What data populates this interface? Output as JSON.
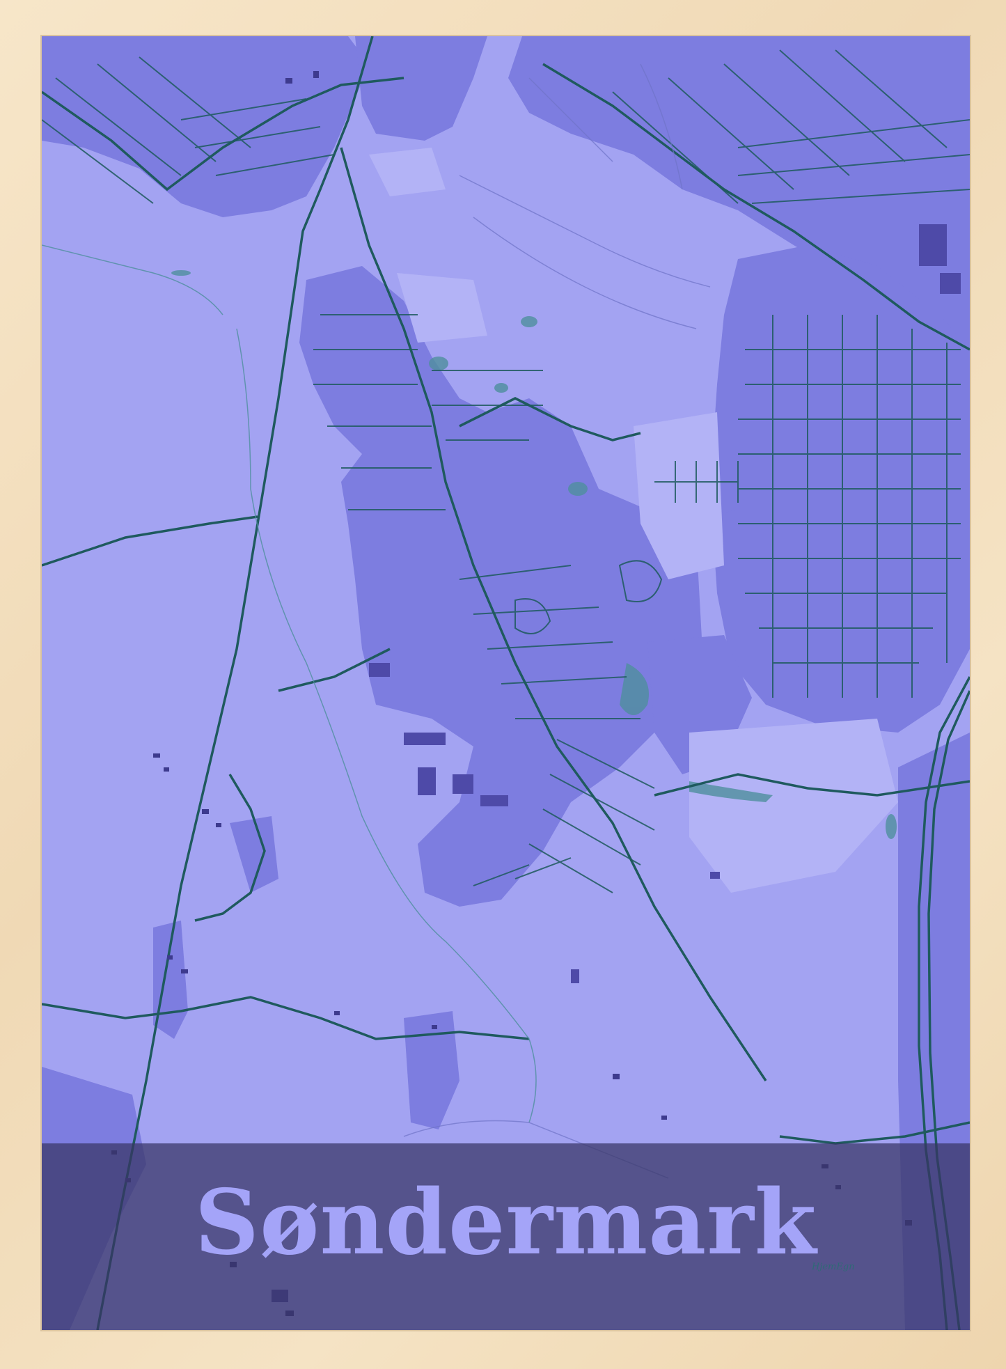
{
  "poster": {
    "title": "Søndermark",
    "signature": "HjemEgn"
  },
  "colors": {
    "frame": "#f0d9b5",
    "background": "#a3a3f2",
    "built_area": "#7d7de0",
    "roads": "#1f5a5e",
    "water": "#4f8e9e",
    "buildings": "#4e4aa8",
    "title_band": "#383564",
    "title_text": "#a4a4f8"
  }
}
